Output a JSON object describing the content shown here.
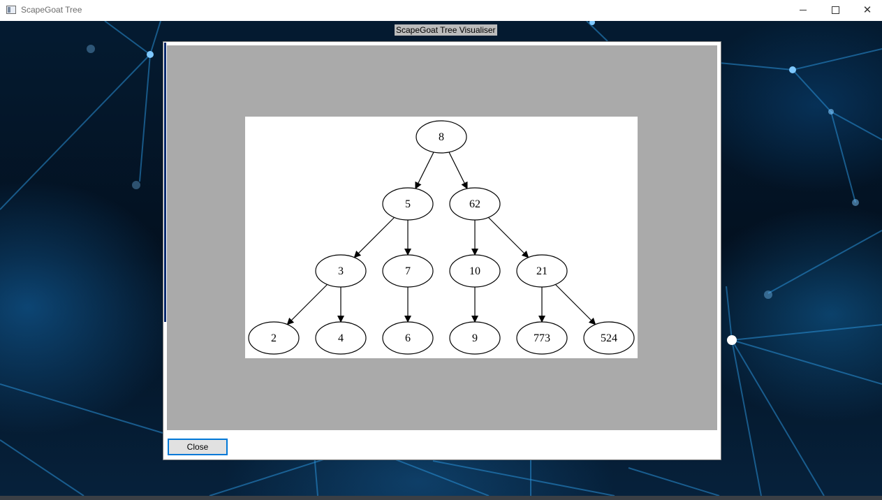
{
  "window": {
    "title": "ScapeGoat Tree",
    "controls": {
      "minimize": "minimize-icon",
      "maximize": "maximize-icon",
      "close": "close-icon"
    },
    "close_glyph": "✕"
  },
  "visualiser": {
    "title": "ScapeGoat Tree Visualiser",
    "close_label": "Close",
    "accent": "#0078d7",
    "canvas_color": "#aaaaaa"
  },
  "tree": {
    "nodes": [
      {
        "id": "n8",
        "label": "8"
      },
      {
        "id": "n5",
        "label": "5"
      },
      {
        "id": "n62",
        "label": "62"
      },
      {
        "id": "n3",
        "label": "3"
      },
      {
        "id": "n7",
        "label": "7"
      },
      {
        "id": "n10",
        "label": "10"
      },
      {
        "id": "n21",
        "label": "21"
      },
      {
        "id": "n2",
        "label": "2"
      },
      {
        "id": "n4",
        "label": "4"
      },
      {
        "id": "n6",
        "label": "6"
      },
      {
        "id": "n9",
        "label": "9"
      },
      {
        "id": "n773",
        "label": "773"
      },
      {
        "id": "n524",
        "label": "524"
      }
    ],
    "edges": [
      [
        "n8",
        "n5"
      ],
      [
        "n8",
        "n62"
      ],
      [
        "n5",
        "n3"
      ],
      [
        "n5",
        "n7"
      ],
      [
        "n62",
        "n10"
      ],
      [
        "n62",
        "n21"
      ],
      [
        "n3",
        "n2"
      ],
      [
        "n3",
        "n4"
      ],
      [
        "n7",
        "n6"
      ],
      [
        "n10",
        "n9"
      ],
      [
        "n21",
        "n773"
      ],
      [
        "n21",
        "n524"
      ]
    ]
  }
}
